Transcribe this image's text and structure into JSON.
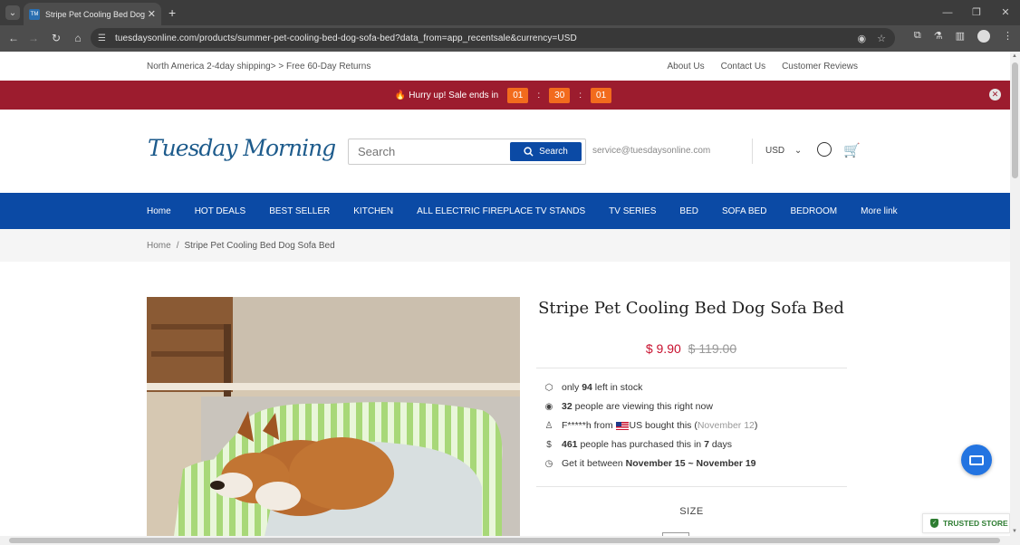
{
  "browser": {
    "tab_title": "Stripe Pet Cooling Bed Dog Sofa",
    "url": "tuesdaysonline.com/products/summer-pet-cooling-bed-dog-sofa-bed?data_from=app_recentsale&currency=USD"
  },
  "topstrip": {
    "promo": "North America 2-4day shipping> > Free 60-Day Returns",
    "links": [
      "About Us",
      "Contact Us",
      "Customer Reviews"
    ]
  },
  "sale": {
    "text": "Hurry up! Sale ends in",
    "hours": "01",
    "minutes": "30",
    "seconds": "01"
  },
  "header": {
    "logo": "Tuesday Morning",
    "search_placeholder": "Search",
    "search_button": "Search",
    "email": "service@tuesdaysonline.com",
    "currency": "USD"
  },
  "nav": {
    "items": [
      "Home",
      "HOT DEALS",
      "BEST SELLER",
      "KITCHEN",
      "ALL ELECTRIC FIREPLACE TV STANDS",
      "TV SERIES",
      "BED",
      "SOFA BED",
      "BEDROOM",
      "More link"
    ]
  },
  "breadcrumb": {
    "home": "Home",
    "sep": "/",
    "current": "Stripe Pet Cooling Bed Dog Sofa Bed"
  },
  "product": {
    "title": "Stripe Pet Cooling Bed Dog Sofa Bed",
    "price": "$ 9.90",
    "original_price": "$ 119.00",
    "stock_pre": "only",
    "stock_count": "94",
    "stock_post": "left in stock",
    "viewers_count": "32",
    "viewers_text": "people are viewing this right now",
    "buyer_name": "F*****h",
    "buyer_from": "from",
    "buyer_country": "US",
    "buyer_text": "bought this (",
    "buyer_date": "November 12",
    "buyer_close": ")",
    "purchased_count": "461",
    "purchased_text": "people has purchased this in",
    "purchased_days": "7",
    "purchased_unit": "days",
    "delivery_pre": "Get it between",
    "delivery_range": "November 15 ~ November 19",
    "size_label": "SIZE"
  },
  "trusted": {
    "label": "TRUSTED STORE"
  },
  "colors": {
    "sale_bar": "#9c1c2e",
    "nav_blue": "#0b4aa5",
    "price_red": "#c8102e",
    "countdown": "#f26b1d"
  }
}
